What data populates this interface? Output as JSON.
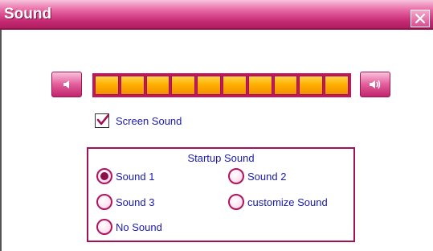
{
  "window": {
    "title": "Sound"
  },
  "icons": {
    "close": "close-icon",
    "volume_down": "speaker-low-icon",
    "volume_up": "speaker-high-icon"
  },
  "volume": {
    "level": 1.0,
    "segments": 10
  },
  "screen_sound": {
    "label": "Screen Sound",
    "checked": true
  },
  "startup_sound": {
    "title": "Startup Sound",
    "options": [
      {
        "label": "Sound 1",
        "selected": true
      },
      {
        "label": "Sound 2",
        "selected": false
      },
      {
        "label": "Sound 3",
        "selected": false
      },
      {
        "label": "customize Sound",
        "selected": false
      },
      {
        "label": "No Sound",
        "selected": false
      }
    ]
  },
  "colors": {
    "accent": "#c2185b",
    "title_bar": "#c52a73",
    "bar_fill": "#ffb000",
    "label_text": "#1a1ab0"
  }
}
